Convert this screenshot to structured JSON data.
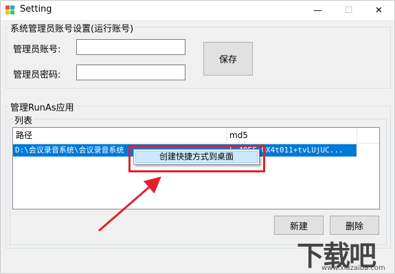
{
  "window": {
    "title": "Setting",
    "controls": {
      "minimize": "—",
      "maximize": "☐",
      "close": "✕"
    }
  },
  "admin_group": {
    "legend": "系统管理员账号设置(运行账号)",
    "account_label": "管理员账号:",
    "account_value": "",
    "password_label": "管理员密码:",
    "password_value": "",
    "save_label": "保存"
  },
  "runas_group": {
    "legend": "管理RunAs应用",
    "list_group": {
      "legend": "列表",
      "columns": [
        "路径",
        "md5"
      ],
      "rows": [
        {
          "path": "D:\\会议录音系统\\会议录音系统",
          "md5": "L 40EF 0X4t011+tvLUjUC..."
        }
      ]
    },
    "new_label": "新建",
    "delete_label": "删除"
  },
  "context_menu": {
    "items": [
      "创建快捷方式到桌面"
    ]
  },
  "annotation": {
    "highlight_color": "#e0202a"
  },
  "watermark": {
    "logo": "下载吧",
    "url": "www.xiazaiba.com"
  },
  "colors": {
    "selection": "#0078d7",
    "menu_hover": "#cce8ff"
  }
}
